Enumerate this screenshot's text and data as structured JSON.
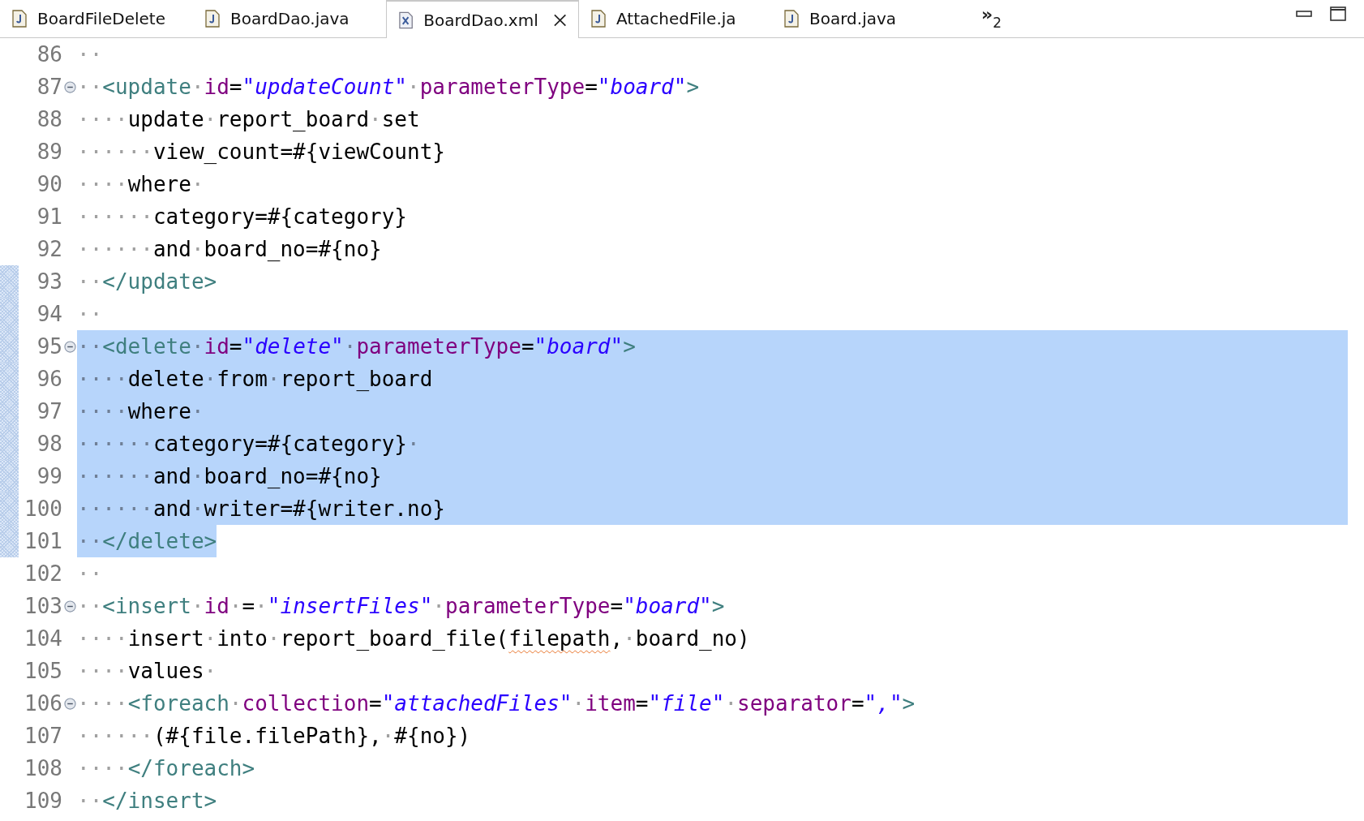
{
  "tabs": [
    {
      "label": "BoardFileDelete",
      "kind": "java",
      "selected": false
    },
    {
      "label": "BoardDao.java",
      "kind": "java",
      "selected": false
    },
    {
      "label": "BoardDao.xml",
      "kind": "xml",
      "selected": true
    },
    {
      "label": "AttachedFile.ja",
      "kind": "java",
      "selected": false
    },
    {
      "label": "Board.java",
      "kind": "java",
      "selected": false
    }
  ],
  "overflow": {
    "glyph": "»",
    "count": "2"
  },
  "lines": [
    {
      "number": "86",
      "fold": false,
      "marked": false,
      "selected": false,
      "tokens": [
        {
          "kind": "ws",
          "text": "··"
        }
      ]
    },
    {
      "number": "87",
      "fold": true,
      "marked": false,
      "selected": false,
      "tokens": [
        {
          "kind": "ws",
          "text": "··"
        },
        {
          "kind": "tag",
          "text": "<update"
        },
        {
          "kind": "ws",
          "text": "·"
        },
        {
          "kind": "attr",
          "text": "id"
        },
        {
          "kind": "text",
          "text": "="
        },
        {
          "kind": "string",
          "text": "\"updateCount\""
        },
        {
          "kind": "ws",
          "text": "·"
        },
        {
          "kind": "attr",
          "text": "parameterType"
        },
        {
          "kind": "text",
          "text": "="
        },
        {
          "kind": "string",
          "text": "\"board\""
        },
        {
          "kind": "tag",
          "text": ">"
        }
      ]
    },
    {
      "number": "88",
      "fold": false,
      "marked": false,
      "selected": false,
      "tokens": [
        {
          "kind": "ws",
          "text": "····"
        },
        {
          "kind": "text",
          "text": "update"
        },
        {
          "kind": "ws",
          "text": "·"
        },
        {
          "kind": "text",
          "text": "report_board"
        },
        {
          "kind": "ws",
          "text": "·"
        },
        {
          "kind": "text",
          "text": "set"
        }
      ]
    },
    {
      "number": "89",
      "fold": false,
      "marked": false,
      "selected": false,
      "tokens": [
        {
          "kind": "ws",
          "text": "······"
        },
        {
          "kind": "text",
          "text": "view_count=#{viewCount}"
        }
      ]
    },
    {
      "number": "90",
      "fold": false,
      "marked": false,
      "selected": false,
      "tokens": [
        {
          "kind": "ws",
          "text": "····"
        },
        {
          "kind": "text",
          "text": "where"
        },
        {
          "kind": "ws",
          "text": "·"
        }
      ]
    },
    {
      "number": "91",
      "fold": false,
      "marked": false,
      "selected": false,
      "tokens": [
        {
          "kind": "ws",
          "text": "······"
        },
        {
          "kind": "text",
          "text": "category=#{category}"
        }
      ]
    },
    {
      "number": "92",
      "fold": false,
      "marked": false,
      "selected": false,
      "tokens": [
        {
          "kind": "ws",
          "text": "······"
        },
        {
          "kind": "text",
          "text": "and"
        },
        {
          "kind": "ws",
          "text": "·"
        },
        {
          "kind": "text",
          "text": "board_no=#{no}"
        }
      ]
    },
    {
      "number": "93",
      "fold": false,
      "marked": true,
      "selected": false,
      "tokens": [
        {
          "kind": "ws",
          "text": "··"
        },
        {
          "kind": "tag",
          "text": "</update>"
        }
      ]
    },
    {
      "number": "94",
      "fold": false,
      "marked": true,
      "selected": false,
      "tokens": [
        {
          "kind": "ws",
          "text": "··"
        }
      ]
    },
    {
      "number": "95",
      "fold": true,
      "marked": true,
      "selected": true,
      "selection_to_end": true,
      "tokens": [
        {
          "kind": "ws",
          "text": "··"
        },
        {
          "kind": "tag",
          "text": "<delete"
        },
        {
          "kind": "ws",
          "text": "·"
        },
        {
          "kind": "attr",
          "text": "id"
        },
        {
          "kind": "text",
          "text": "="
        },
        {
          "kind": "string",
          "text": "\"delete\""
        },
        {
          "kind": "ws",
          "text": "·"
        },
        {
          "kind": "attr",
          "text": "parameterType"
        },
        {
          "kind": "text",
          "text": "="
        },
        {
          "kind": "string",
          "text": "\"board\""
        },
        {
          "kind": "tag",
          "text": ">"
        }
      ]
    },
    {
      "number": "96",
      "fold": false,
      "marked": true,
      "selected": true,
      "selection_to_end": true,
      "tokens": [
        {
          "kind": "ws",
          "text": "····"
        },
        {
          "kind": "text",
          "text": "delete"
        },
        {
          "kind": "ws",
          "text": "·"
        },
        {
          "kind": "text",
          "text": "from"
        },
        {
          "kind": "ws",
          "text": "·"
        },
        {
          "kind": "text",
          "text": "report_board"
        }
      ]
    },
    {
      "number": "97",
      "fold": false,
      "marked": true,
      "selected": true,
      "selection_to_end": true,
      "tokens": [
        {
          "kind": "ws",
          "text": "····"
        },
        {
          "kind": "text",
          "text": "where"
        },
        {
          "kind": "ws",
          "text": "·"
        }
      ]
    },
    {
      "number": "98",
      "fold": false,
      "marked": true,
      "selected": true,
      "selection_to_end": true,
      "tokens": [
        {
          "kind": "ws",
          "text": "······"
        },
        {
          "kind": "text",
          "text": "category=#{category}"
        },
        {
          "kind": "ws",
          "text": "·"
        }
      ]
    },
    {
      "number": "99",
      "fold": false,
      "marked": true,
      "selected": true,
      "selection_to_end": true,
      "tokens": [
        {
          "kind": "ws",
          "text": "······"
        },
        {
          "kind": "text",
          "text": "and"
        },
        {
          "kind": "ws",
          "text": "·"
        },
        {
          "kind": "text",
          "text": "board_no=#{no}"
        }
      ]
    },
    {
      "number": "100",
      "fold": false,
      "marked": true,
      "selected": true,
      "selection_to_end": true,
      "tokens": [
        {
          "kind": "ws",
          "text": "······"
        },
        {
          "kind": "text",
          "text": "and"
        },
        {
          "kind": "ws",
          "text": "·"
        },
        {
          "kind": "text",
          "text": "writer=#{writer.no}"
        }
      ]
    },
    {
      "number": "101",
      "fold": false,
      "marked": true,
      "selected": true,
      "selection_to_end": false,
      "tokens": [
        {
          "kind": "ws",
          "text": "··"
        },
        {
          "kind": "tag",
          "text": "</delete>"
        }
      ]
    },
    {
      "number": "102",
      "fold": false,
      "marked": false,
      "selected": false,
      "tokens": [
        {
          "kind": "ws",
          "text": "··"
        }
      ]
    },
    {
      "number": "103",
      "fold": true,
      "marked": false,
      "selected": false,
      "tokens": [
        {
          "kind": "ws",
          "text": "··"
        },
        {
          "kind": "tag",
          "text": "<insert"
        },
        {
          "kind": "ws",
          "text": "·"
        },
        {
          "kind": "attr",
          "text": "id"
        },
        {
          "kind": "ws",
          "text": "·"
        },
        {
          "kind": "text",
          "text": "="
        },
        {
          "kind": "ws",
          "text": "·"
        },
        {
          "kind": "string",
          "text": "\"insertFiles\""
        },
        {
          "kind": "ws",
          "text": "·"
        },
        {
          "kind": "attr",
          "text": "parameterType"
        },
        {
          "kind": "text",
          "text": "="
        },
        {
          "kind": "string",
          "text": "\"board\""
        },
        {
          "kind": "tag",
          "text": ">"
        }
      ]
    },
    {
      "number": "104",
      "fold": false,
      "marked": false,
      "selected": false,
      "tokens": [
        {
          "kind": "ws",
          "text": "····"
        },
        {
          "kind": "text",
          "text": "insert"
        },
        {
          "kind": "ws",
          "text": "·"
        },
        {
          "kind": "text",
          "text": "into"
        },
        {
          "kind": "ws",
          "text": "·"
        },
        {
          "kind": "text",
          "text": "report_board_file("
        },
        {
          "kind": "misspelled",
          "text": "filepath"
        },
        {
          "kind": "text",
          "text": ","
        },
        {
          "kind": "ws",
          "text": "·"
        },
        {
          "kind": "text",
          "text": "board_no)"
        }
      ]
    },
    {
      "number": "105",
      "fold": false,
      "marked": false,
      "selected": false,
      "tokens": [
        {
          "kind": "ws",
          "text": "····"
        },
        {
          "kind": "text",
          "text": "values"
        },
        {
          "kind": "ws",
          "text": "·"
        }
      ]
    },
    {
      "number": "106",
      "fold": true,
      "marked": false,
      "selected": false,
      "tokens": [
        {
          "kind": "ws",
          "text": "····"
        },
        {
          "kind": "tag",
          "text": "<foreach"
        },
        {
          "kind": "ws",
          "text": "·"
        },
        {
          "kind": "attr",
          "text": "collection"
        },
        {
          "kind": "text",
          "text": "="
        },
        {
          "kind": "string",
          "text": "\"attachedFiles\""
        },
        {
          "kind": "ws",
          "text": "·"
        },
        {
          "kind": "attr",
          "text": "item"
        },
        {
          "kind": "text",
          "text": "="
        },
        {
          "kind": "string",
          "text": "\"file\""
        },
        {
          "kind": "ws",
          "text": "·"
        },
        {
          "kind": "attr",
          "text": "separator"
        },
        {
          "kind": "text",
          "text": "="
        },
        {
          "kind": "string",
          "text": "\",\""
        },
        {
          "kind": "tag",
          "text": ">"
        }
      ]
    },
    {
      "number": "107",
      "fold": false,
      "marked": false,
      "selected": false,
      "tokens": [
        {
          "kind": "ws",
          "text": "······"
        },
        {
          "kind": "text",
          "text": "(#{file.filePath},"
        },
        {
          "kind": "ws",
          "text": "·"
        },
        {
          "kind": "text",
          "text": "#{no})"
        }
      ]
    },
    {
      "number": "108",
      "fold": false,
      "marked": false,
      "selected": false,
      "tokens": [
        {
          "kind": "ws",
          "text": "····"
        },
        {
          "kind": "tag",
          "text": "</foreach>"
        }
      ]
    },
    {
      "number": "109",
      "fold": false,
      "marked": false,
      "selected": false,
      "tokens": [
        {
          "kind": "ws",
          "text": "··"
        },
        {
          "kind": "tag",
          "text": "</insert>"
        }
      ]
    }
  ]
}
